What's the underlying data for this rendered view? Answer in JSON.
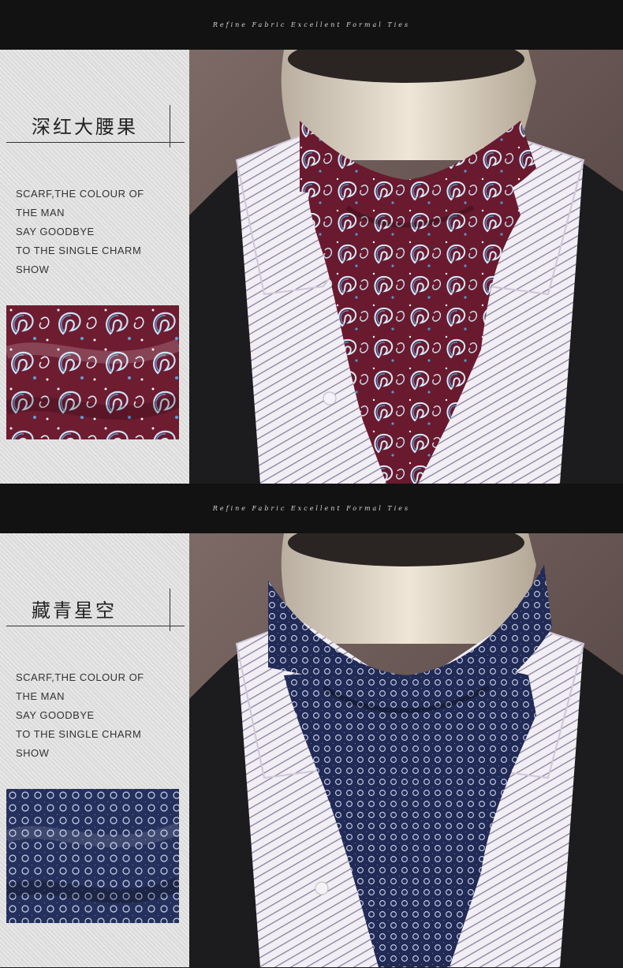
{
  "sections": [
    {
      "banner": "Refine Fabric Excellent Formal Ties",
      "title": "深红大腰果",
      "description": [
        "SCARF,THE COLOUR OF",
        "THE MAN",
        "SAY GOODBYE",
        "TO THE SINGLE CHARM",
        "SHOW"
      ],
      "tie_color": "#7a1f33",
      "tie_accent": "#4d8cc9"
    },
    {
      "banner": "Refine Fabric Excellent Formal Ties",
      "title": "藏青星空",
      "description": [
        "SCARF,THE COLOUR OF",
        "THE MAN",
        "SAY GOODBYE",
        "TO THE SINGLE CHARM",
        "SHOW"
      ],
      "tie_color": "#28305f",
      "tie_accent": "#8fb2e0"
    }
  ]
}
